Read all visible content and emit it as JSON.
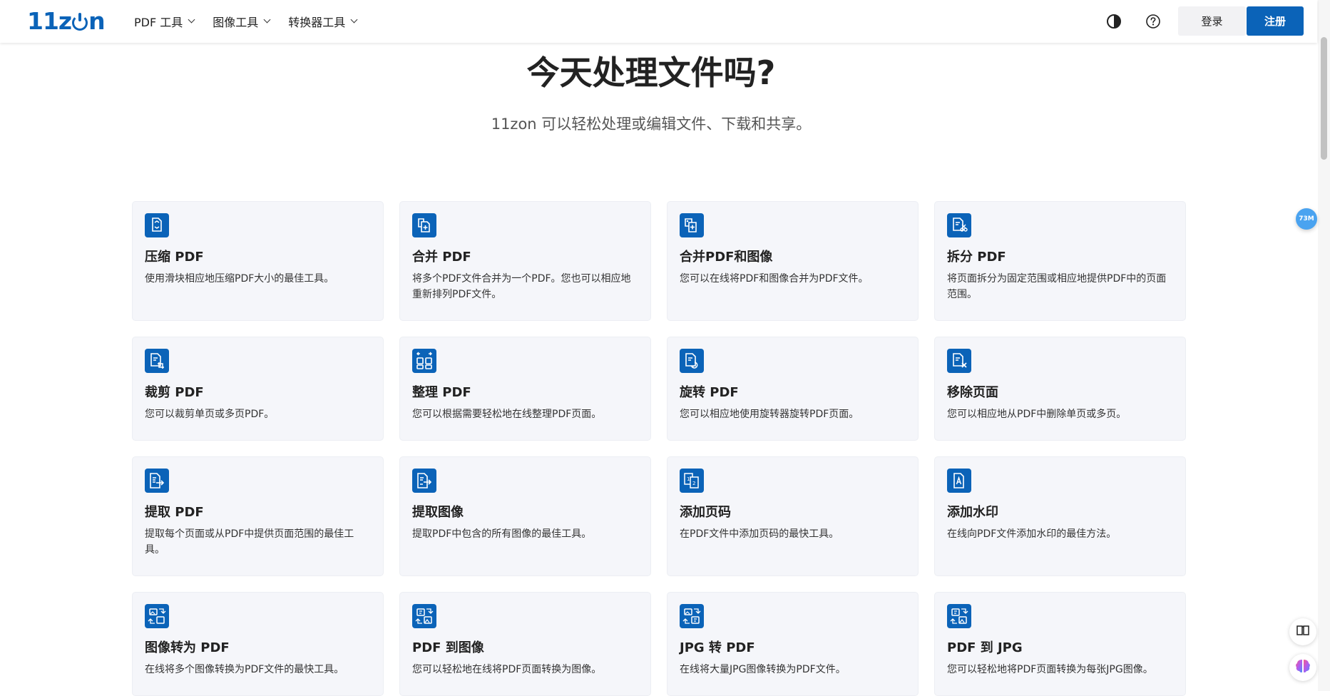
{
  "header": {
    "logo_text": "11zon",
    "nav": [
      {
        "label": "PDF 工具"
      },
      {
        "label": "图像工具"
      },
      {
        "label": "转换器工具"
      }
    ],
    "login_label": "登录",
    "register_label": "注册"
  },
  "hero": {
    "title": "今天处理文件吗?",
    "subtitle": "11zon 可以轻松处理或编辑文件、下载和共享。"
  },
  "tools": [
    {
      "title": "压缩 PDF",
      "desc": "使用滑块相应地压缩PDF大小的最佳工具。",
      "icon": "compress-pdf-icon"
    },
    {
      "title": "合并 PDF",
      "desc": "将多个PDF文件合并为一个PDF。您也可以相应地重新排列PDF文件。",
      "icon": "merge-pdf-icon"
    },
    {
      "title": "合并PDF和图像",
      "desc": "您可以在线将PDF和图像合并为PDF文件。",
      "icon": "merge-pdf-image-icon"
    },
    {
      "title": "拆分 PDF",
      "desc": "将页面拆分为固定范围或相应地提供PDF中的页面范围。",
      "icon": "split-pdf-icon"
    },
    {
      "title": "裁剪 PDF",
      "desc": "您可以裁剪单页或多页PDF。",
      "icon": "crop-pdf-icon"
    },
    {
      "title": "整理 PDF",
      "desc": "您可以根据需要轻松地在线整理PDF页面。",
      "icon": "organize-pdf-icon"
    },
    {
      "title": "旋转 PDF",
      "desc": "您可以相应地使用旋转器旋转PDF页面。",
      "icon": "rotate-pdf-icon"
    },
    {
      "title": "移除页面",
      "desc": "您可以相应地从PDF中删除单页或多页。",
      "icon": "remove-pages-icon"
    },
    {
      "title": "提取 PDF",
      "desc": "提取每个页面或从PDF中提供页面范围的最佳工具。",
      "icon": "extract-pdf-icon"
    },
    {
      "title": "提取图像",
      "desc": "提取PDF中包含的所有图像的最佳工具。",
      "icon": "extract-images-icon"
    },
    {
      "title": "添加页码",
      "desc": "在PDF文件中添加页码的最快工具。",
      "icon": "add-page-numbers-icon"
    },
    {
      "title": "添加水印",
      "desc": "在线向PDF文件添加水印的最佳方法。",
      "icon": "add-watermark-icon"
    },
    {
      "title": "图像转为 PDF",
      "desc": "在线将多个图像转换为PDF文件的最快工具。",
      "icon": "image-to-pdf-icon"
    },
    {
      "title": "PDF 到图像",
      "desc": "您可以轻松地在线将PDF页面转换为图像。",
      "icon": "pdf-to-image-icon"
    },
    {
      "title": "JPG 转 PDF",
      "desc": "在线将大量JPG图像转换为PDF文件。",
      "icon": "jpg-to-pdf-icon"
    },
    {
      "title": "PDF 到 JPG",
      "desc": "您可以轻松地将PDF页面转换为每张JPG图像。",
      "icon": "pdf-to-jpg-icon"
    }
  ],
  "floating": {
    "memory_badge": "73M"
  },
  "colors": {
    "brand": "#0b63b8",
    "card_bg": "#f5f6fa"
  }
}
